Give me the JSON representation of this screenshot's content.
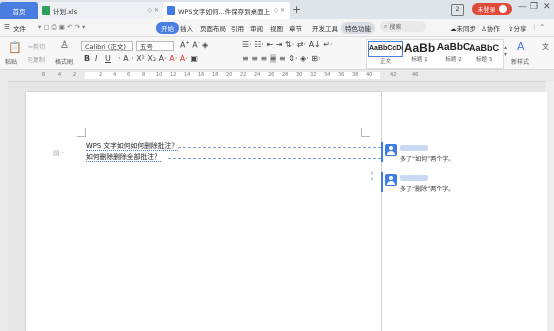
{
  "tabs": {
    "home": "首页",
    "file1": "计划.xls",
    "file2": "WPS文字如何...件保存到桌面上",
    "plus": "+"
  },
  "window": {
    "number": "2",
    "login": "未登录",
    "minimize": "—",
    "restore": "❐",
    "close": "✕"
  },
  "ribbon": {
    "file_menu": "文件",
    "tabs": [
      "开始",
      "插入",
      "页面布局",
      "引用",
      "审阅",
      "视图",
      "章节",
      "开发工具",
      "特色功能"
    ],
    "search": "搜索",
    "unsynced": "未同步",
    "collab": "协作",
    "share": "分享"
  },
  "toolbar": {
    "paste": "粘贴",
    "cut": "剪切",
    "copy": "复制",
    "format_painter": "格式刷",
    "font": "Calibri (正文)",
    "size": "五号",
    "styles": [
      {
        "sample": "AaBbCcDd",
        "label": "正文"
      },
      {
        "sample": "AaBb",
        "label": "标题 1"
      },
      {
        "sample": "AaBbC",
        "label": "标题 2"
      },
      {
        "sample": "AaBbC",
        "label": "标题 3"
      }
    ],
    "new_style": "新样式"
  },
  "ruler": {
    "numbers": [
      "6",
      "4",
      "2",
      "2",
      "4",
      "6",
      "8",
      "10",
      "12",
      "14",
      "16",
      "18",
      "20",
      "22",
      "24",
      "26",
      "28",
      "30",
      "32",
      "34",
      "36",
      "38",
      "40",
      "42",
      "46"
    ]
  },
  "document": {
    "line1": "WPS 文字如何如何删除批注？",
    "line2": "如何删除删除全部批注？"
  },
  "comments": [
    {
      "text": "多了“如何”两个字。"
    },
    {
      "text": "多了“删除”两个字。"
    }
  ],
  "colors": {
    "accent": "#4a7de0",
    "login": "#e04a3a",
    "comment": "#3f7ce3"
  }
}
